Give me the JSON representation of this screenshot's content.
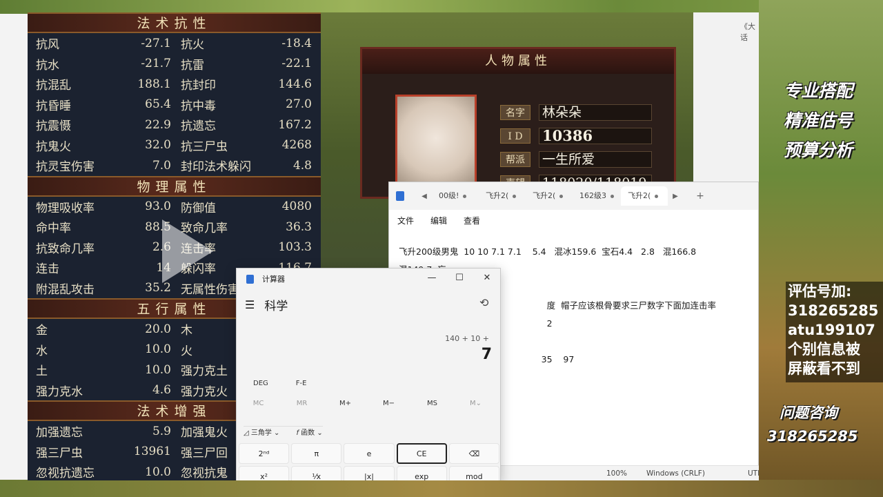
{
  "game": {
    "resist_title": "法术抗性",
    "resist_rows": [
      [
        "抗风",
        "-27.1",
        "抗火",
        "-18.4"
      ],
      [
        "抗水",
        "-21.7",
        "抗雷",
        "-22.1"
      ],
      [
        "抗混乱",
        "188.1",
        "抗封印",
        "144.6"
      ],
      [
        "抗昏睡",
        "65.4",
        "抗中毒",
        "27.0"
      ],
      [
        "抗震慑",
        "22.9",
        "抗遗忘",
        "167.2"
      ],
      [
        "抗鬼火",
        "32.0",
        "抗三尸虫",
        "4268"
      ],
      [
        "抗灵宝伤害",
        "7.0",
        "封印法术躲闪",
        "4.8"
      ]
    ],
    "phys_title": "物理属性",
    "phys_rows": [
      [
        "物理吸收率",
        "93.0",
        "防御值",
        "4080"
      ],
      [
        "命中率",
        "88.5",
        "致命几率",
        "36.3"
      ],
      [
        "抗致命几率",
        "2.6",
        "连击率",
        "103.3"
      ],
      [
        "连击",
        "14",
        "躲闪率",
        "116.7"
      ],
      [
        "附混乱攻击",
        "35.2",
        "无属性伤害",
        ""
      ]
    ],
    "five_title": "五行属性",
    "five_rows": [
      [
        "金",
        "20.0",
        "木",
        ""
      ],
      [
        "水",
        "10.0",
        "火",
        ""
      ],
      [
        "土",
        "10.0",
        "强力克土",
        ""
      ],
      [
        "强力克水",
        "4.6",
        "强力克火",
        ""
      ]
    ],
    "boost_title": "法术增强",
    "boost_rows": [
      [
        "加强遗忘",
        "5.9",
        "加强鬼火",
        ""
      ],
      [
        "强三尸虫",
        "13961",
        "强三尸回",
        ""
      ],
      [
        "忽视抗遗忘",
        "10.0",
        "忽视抗鬼",
        ""
      ]
    ],
    "char_title": "人物属性",
    "char_info": [
      {
        "label": "名字",
        "value": "林朵朵"
      },
      {
        "label": "I D",
        "value": "10386"
      },
      {
        "label": "帮派",
        "value": "一生所爱"
      },
      {
        "label": "声望",
        "value": "118020/118019"
      }
    ]
  },
  "right_strip": {
    "tab_text": "《大话"
  },
  "notepad": {
    "tabs": [
      "00级!",
      "飞升2(",
      "飞升2(",
      "162级3",
      "飞升2("
    ],
    "active_tab": 4,
    "add_tab": "+",
    "menu": [
      "文件",
      "编辑",
      "查看"
    ],
    "lines": [
      "飞升200级男鬼  10 10 7.1 7.1    5.4   混冰159.6  宝石4.4   2.8   混166.8",
      "混149.7  忘",
      "",
      "                                                      度  帽子应该根骨要求三尸数字下面加连击率",
      "                                                      2",
      "",
      "                                                    35    97"
    ],
    "status": {
      "zoom": "100%",
      "eol": "Windows (CRLF)",
      "enc": "UTF"
    }
  },
  "calculator": {
    "title": "计算器",
    "mode": "科学",
    "expression": "140 + 10 +",
    "result": "7",
    "angle_mode": "DEG",
    "fe": "F-E",
    "memory": [
      "MC",
      "MR",
      "M+",
      "M−",
      "MS",
      "M⌄"
    ],
    "trig_label": "三角学",
    "func_label": "函数",
    "keys": [
      "2ⁿᵈ",
      "π",
      "e",
      "CE",
      "⌫",
      "x²",
      "¹⁄x",
      "|x|",
      "exp",
      "mod"
    ]
  },
  "promo": {
    "lines": [
      "专业搭配",
      "精准估号",
      "预算分析"
    ],
    "contact": [
      "评估号加:",
      "318265285",
      "atu199107",
      "个别信息被",
      "屏蔽看不到"
    ],
    "qa_title": "问题咨询",
    "qa_number": "318265285"
  }
}
